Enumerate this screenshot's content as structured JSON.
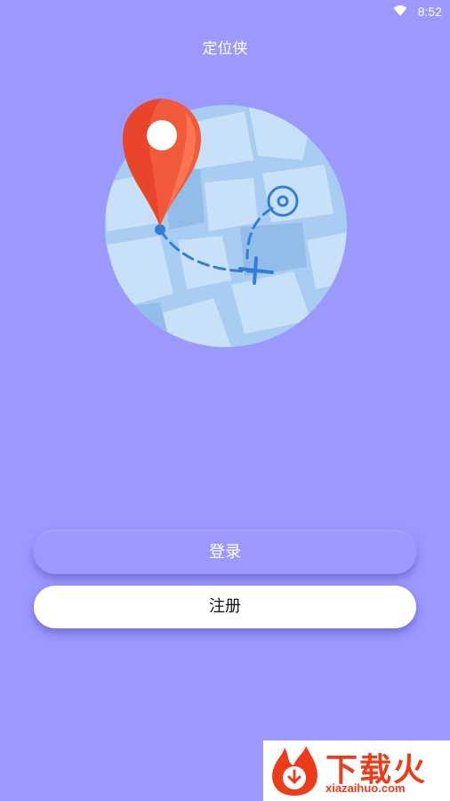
{
  "status_bar": {
    "time": "8:52",
    "icons": [
      "wifi-icon"
    ]
  },
  "app": {
    "title": "定位侠"
  },
  "hero": {
    "icons": [
      "map-circle",
      "location-pin-icon",
      "target-icon",
      "route-path",
      "plane-icon"
    ]
  },
  "actions": {
    "login_label": "登录",
    "register_label": "注册"
  },
  "watermark": {
    "brand": "下载火",
    "domain": "xiazaihuo.com"
  },
  "colors": {
    "background": "#9b99fe",
    "pin": "#e8452a",
    "map": "#a9ccf2",
    "route": "#2f7fd8",
    "button_white": "#ffffff",
    "watermark": "#ec3c1a"
  }
}
